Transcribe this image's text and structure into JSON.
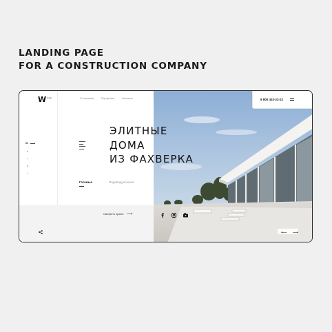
{
  "caption": {
    "line1": "LANDING PAGE",
    "line2": "FOR A CONSTRUCTION COMPANY"
  },
  "header": {
    "logo_mark": "W",
    "logo_sub": "studio",
    "nav": [
      "О компании",
      "Портфолио",
      "Контакты"
    ],
    "phone": "8 800 433-23-22"
  },
  "hero": {
    "title_lines": [
      "ЭЛИТНЫЕ",
      "ДОМА",
      "ИЗ ФАХВЕРКА"
    ],
    "pager_current": "01",
    "tabs": {
      "active": "Готовые",
      "inactive": "Индивидуальные"
    },
    "cta_label": "Смотреть проект",
    "cta_arrow": "⟶"
  },
  "socials": [
    "facebook-icon",
    "instagram-icon",
    "youtube-icon"
  ],
  "slider": {
    "prev": "⟵",
    "next": "⟶"
  },
  "colors": {
    "background": "#f0f0f0",
    "frame_border": "#2a2a2a",
    "sky": "#9fb8d6",
    "text": "#111111"
  }
}
